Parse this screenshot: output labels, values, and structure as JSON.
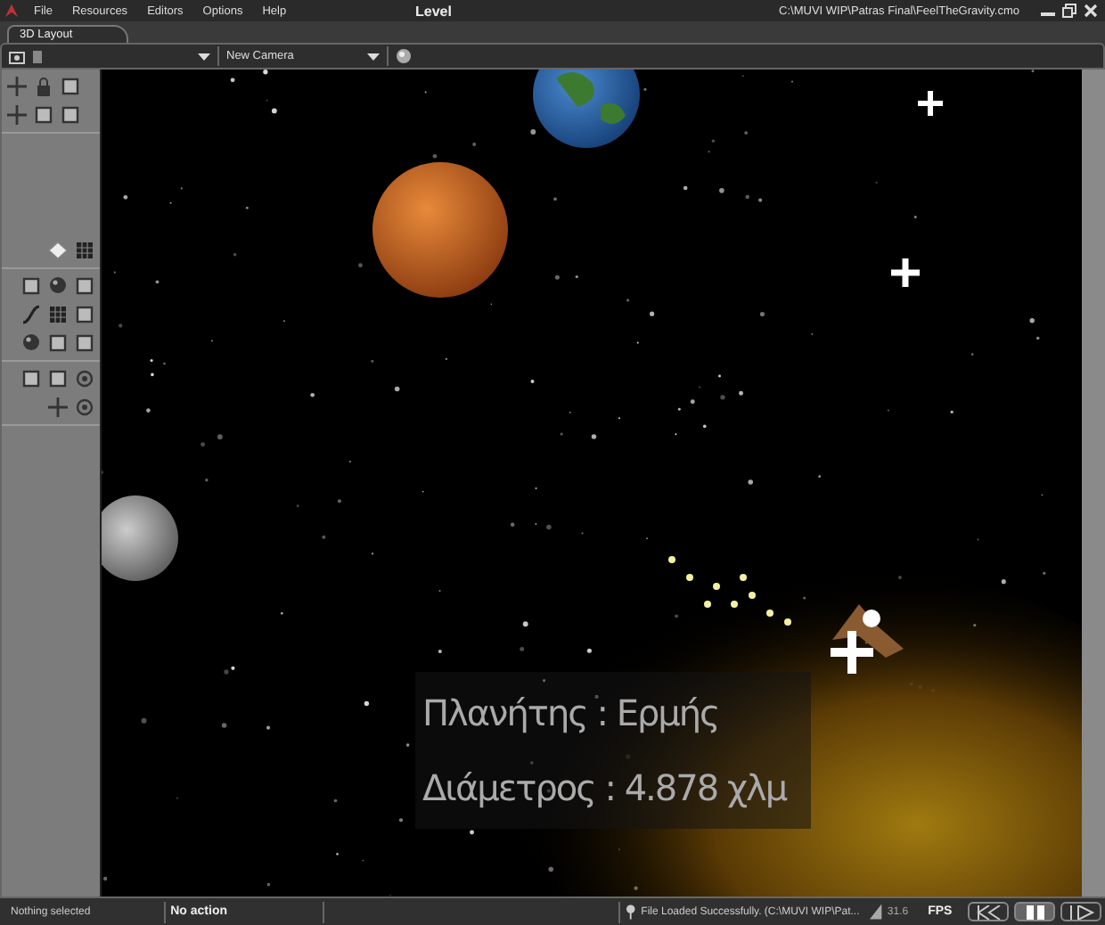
{
  "menu": [
    "File",
    "Resources",
    "Editors",
    "Options",
    "Help"
  ],
  "window": {
    "title": "Level",
    "path": "C:\\MUVI WIP\\Patras Final\\FeelTheGravity.cmo"
  },
  "tabs": [
    {
      "label": "3D Layout",
      "selected": true
    }
  ],
  "toolbar": {
    "camera": "New Camera"
  },
  "overlay": [
    "Πλανήτης : Ερμής",
    "Διάμετρος : 4.878 χλμ"
  ],
  "status_bar": {
    "selection": "Nothing selected",
    "action": "No action",
    "message": "File Loaded Successfully. (C:\\MUVI WIP\\Pat...",
    "fps_value": "31.6",
    "fps_label": "FPS"
  }
}
